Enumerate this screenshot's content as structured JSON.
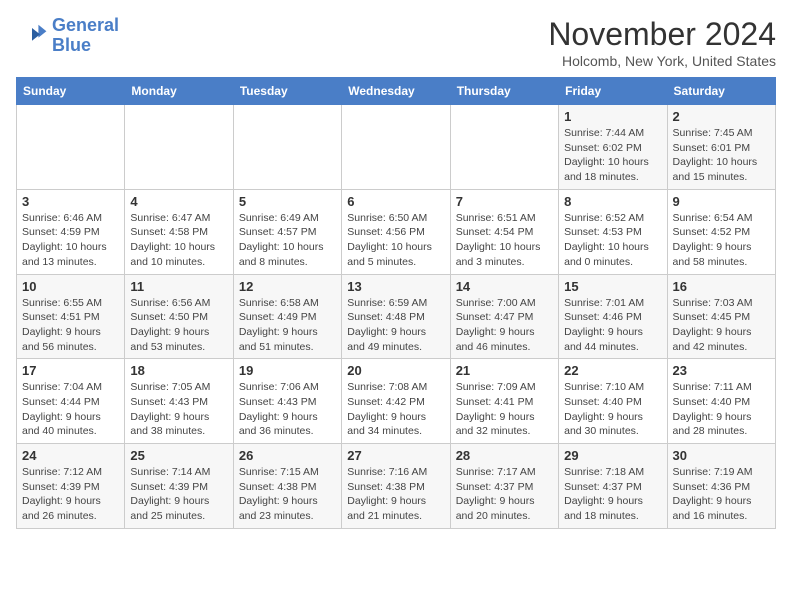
{
  "logo": {
    "line1": "General",
    "line2": "Blue"
  },
  "title": "November 2024",
  "subtitle": "Holcomb, New York, United States",
  "days_of_week": [
    "Sunday",
    "Monday",
    "Tuesday",
    "Wednesday",
    "Thursday",
    "Friday",
    "Saturday"
  ],
  "weeks": [
    [
      {
        "day": "",
        "info": ""
      },
      {
        "day": "",
        "info": ""
      },
      {
        "day": "",
        "info": ""
      },
      {
        "day": "",
        "info": ""
      },
      {
        "day": "",
        "info": ""
      },
      {
        "day": "1",
        "info": "Sunrise: 7:44 AM\nSunset: 6:02 PM\nDaylight: 10 hours and 18 minutes."
      },
      {
        "day": "2",
        "info": "Sunrise: 7:45 AM\nSunset: 6:01 PM\nDaylight: 10 hours and 15 minutes."
      }
    ],
    [
      {
        "day": "3",
        "info": "Sunrise: 6:46 AM\nSunset: 4:59 PM\nDaylight: 10 hours and 13 minutes."
      },
      {
        "day": "4",
        "info": "Sunrise: 6:47 AM\nSunset: 4:58 PM\nDaylight: 10 hours and 10 minutes."
      },
      {
        "day": "5",
        "info": "Sunrise: 6:49 AM\nSunset: 4:57 PM\nDaylight: 10 hours and 8 minutes."
      },
      {
        "day": "6",
        "info": "Sunrise: 6:50 AM\nSunset: 4:56 PM\nDaylight: 10 hours and 5 minutes."
      },
      {
        "day": "7",
        "info": "Sunrise: 6:51 AM\nSunset: 4:54 PM\nDaylight: 10 hours and 3 minutes."
      },
      {
        "day": "8",
        "info": "Sunrise: 6:52 AM\nSunset: 4:53 PM\nDaylight: 10 hours and 0 minutes."
      },
      {
        "day": "9",
        "info": "Sunrise: 6:54 AM\nSunset: 4:52 PM\nDaylight: 9 hours and 58 minutes."
      }
    ],
    [
      {
        "day": "10",
        "info": "Sunrise: 6:55 AM\nSunset: 4:51 PM\nDaylight: 9 hours and 56 minutes."
      },
      {
        "day": "11",
        "info": "Sunrise: 6:56 AM\nSunset: 4:50 PM\nDaylight: 9 hours and 53 minutes."
      },
      {
        "day": "12",
        "info": "Sunrise: 6:58 AM\nSunset: 4:49 PM\nDaylight: 9 hours and 51 minutes."
      },
      {
        "day": "13",
        "info": "Sunrise: 6:59 AM\nSunset: 4:48 PM\nDaylight: 9 hours and 49 minutes."
      },
      {
        "day": "14",
        "info": "Sunrise: 7:00 AM\nSunset: 4:47 PM\nDaylight: 9 hours and 46 minutes."
      },
      {
        "day": "15",
        "info": "Sunrise: 7:01 AM\nSunset: 4:46 PM\nDaylight: 9 hours and 44 minutes."
      },
      {
        "day": "16",
        "info": "Sunrise: 7:03 AM\nSunset: 4:45 PM\nDaylight: 9 hours and 42 minutes."
      }
    ],
    [
      {
        "day": "17",
        "info": "Sunrise: 7:04 AM\nSunset: 4:44 PM\nDaylight: 9 hours and 40 minutes."
      },
      {
        "day": "18",
        "info": "Sunrise: 7:05 AM\nSunset: 4:43 PM\nDaylight: 9 hours and 38 minutes."
      },
      {
        "day": "19",
        "info": "Sunrise: 7:06 AM\nSunset: 4:43 PM\nDaylight: 9 hours and 36 minutes."
      },
      {
        "day": "20",
        "info": "Sunrise: 7:08 AM\nSunset: 4:42 PM\nDaylight: 9 hours and 34 minutes."
      },
      {
        "day": "21",
        "info": "Sunrise: 7:09 AM\nSunset: 4:41 PM\nDaylight: 9 hours and 32 minutes."
      },
      {
        "day": "22",
        "info": "Sunrise: 7:10 AM\nSunset: 4:40 PM\nDaylight: 9 hours and 30 minutes."
      },
      {
        "day": "23",
        "info": "Sunrise: 7:11 AM\nSunset: 4:40 PM\nDaylight: 9 hours and 28 minutes."
      }
    ],
    [
      {
        "day": "24",
        "info": "Sunrise: 7:12 AM\nSunset: 4:39 PM\nDaylight: 9 hours and 26 minutes."
      },
      {
        "day": "25",
        "info": "Sunrise: 7:14 AM\nSunset: 4:39 PM\nDaylight: 9 hours and 25 minutes."
      },
      {
        "day": "26",
        "info": "Sunrise: 7:15 AM\nSunset: 4:38 PM\nDaylight: 9 hours and 23 minutes."
      },
      {
        "day": "27",
        "info": "Sunrise: 7:16 AM\nSunset: 4:38 PM\nDaylight: 9 hours and 21 minutes."
      },
      {
        "day": "28",
        "info": "Sunrise: 7:17 AM\nSunset: 4:37 PM\nDaylight: 9 hours and 20 minutes."
      },
      {
        "day": "29",
        "info": "Sunrise: 7:18 AM\nSunset: 4:37 PM\nDaylight: 9 hours and 18 minutes."
      },
      {
        "day": "30",
        "info": "Sunrise: 7:19 AM\nSunset: 4:36 PM\nDaylight: 9 hours and 16 minutes."
      }
    ]
  ]
}
